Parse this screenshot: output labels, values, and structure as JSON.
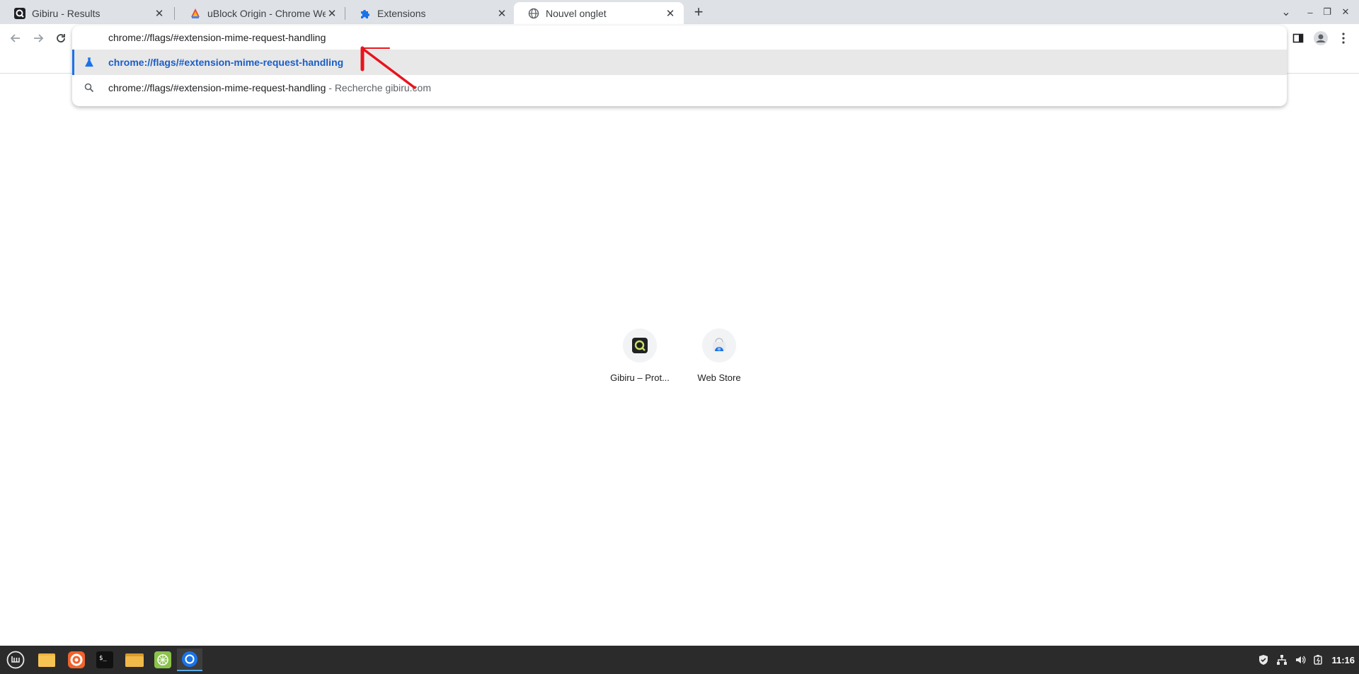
{
  "tabs": [
    {
      "title": "Gibiru - Results",
      "favicon": "gibiru-icon",
      "active": false
    },
    {
      "title": "uBlock Origin - Chrome Web S",
      "favicon": "ublock-icon",
      "active": false
    },
    {
      "title": "Extensions",
      "favicon": "puzzle-icon",
      "active": false
    },
    {
      "title": "Nouvel onglet",
      "favicon": "globe-icon",
      "active": true
    }
  ],
  "tab_close_glyph": "✕",
  "new_tab_glyph": "+",
  "window_controls": {
    "dropdown": "⌄",
    "minimize": "–",
    "restore": "❐",
    "close": "✕"
  },
  "omnibox": {
    "input_text": "chrome://flags/#extension-mime-request-handling",
    "suggestions": [
      {
        "text": "chrome://flags/#extension-mime-request-handling",
        "suffix": "",
        "icon": "flask-icon",
        "selected": true
      },
      {
        "text": "chrome://flags/#extension-mime-request-handling",
        "suffix": " - Recherche gibiru.com",
        "icon": "search-icon",
        "selected": false
      }
    ]
  },
  "shortcuts": [
    {
      "label": "Gibiru – Prot...",
      "icon": "gibiru-icon"
    },
    {
      "label": "Web Store",
      "icon": "web-store-icon"
    }
  ],
  "taskbar": {
    "apps": [
      "mint-menu-icon",
      "files-folder-icon",
      "firefox-icon",
      "terminal-icon",
      "file-manager-icon",
      "spreadsheet-icon",
      "chrome-icon"
    ],
    "clock": "11:16"
  },
  "colors": {
    "accent": "#1a73e8",
    "annotation_arrow": "#e8141c",
    "taskbar": "#2b2b2b"
  }
}
